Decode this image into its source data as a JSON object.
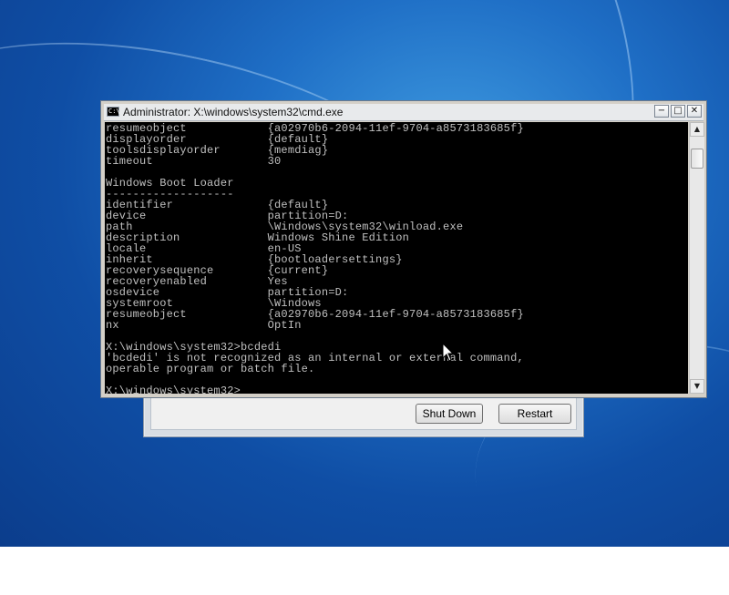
{
  "window": {
    "title": "Administrator: X:\\windows\\system32\\cmd.exe",
    "icon_name": "cmd-icon",
    "icon_text": "C:\\",
    "buttons": {
      "minimize": "−",
      "maximize": "□",
      "close": "✕"
    }
  },
  "console": {
    "lines": [
      "resumeobject            {a02970b6-2094-11ef-9704-a8573183685f}",
      "displayorder            {default}",
      "toolsdisplayorder       {memdiag}",
      "timeout                 30",
      "",
      "Windows Boot Loader",
      "-------------------",
      "identifier              {default}",
      "device                  partition=D:",
      "path                    \\Windows\\system32\\winload.exe",
      "description             Windows Shine Edition",
      "locale                  en-US",
      "inherit                 {bootloadersettings}",
      "recoverysequence        {current}",
      "recoveryenabled         Yes",
      "osdevice                partition=D:",
      "systemroot              \\Windows",
      "resumeobject            {a02970b6-2094-11ef-9704-a8573183685f}",
      "nx                      OptIn",
      "",
      "X:\\windows\\system32>bcdedi",
      "'bcdedi' is not recognized as an internal or external command,",
      "operable program or batch file.",
      "",
      "X:\\windows\\system32>"
    ]
  },
  "scrollbar": {
    "up_arrow": "▲",
    "down_arrow": "▼"
  },
  "recovery_dialog": {
    "shutdown_label": "Shut Down",
    "restart_label": "Restart"
  },
  "colors": {
    "console_bg": "#000000",
    "console_text": "#c0c0c0",
    "desktop_accent": "#1f6fc6"
  }
}
